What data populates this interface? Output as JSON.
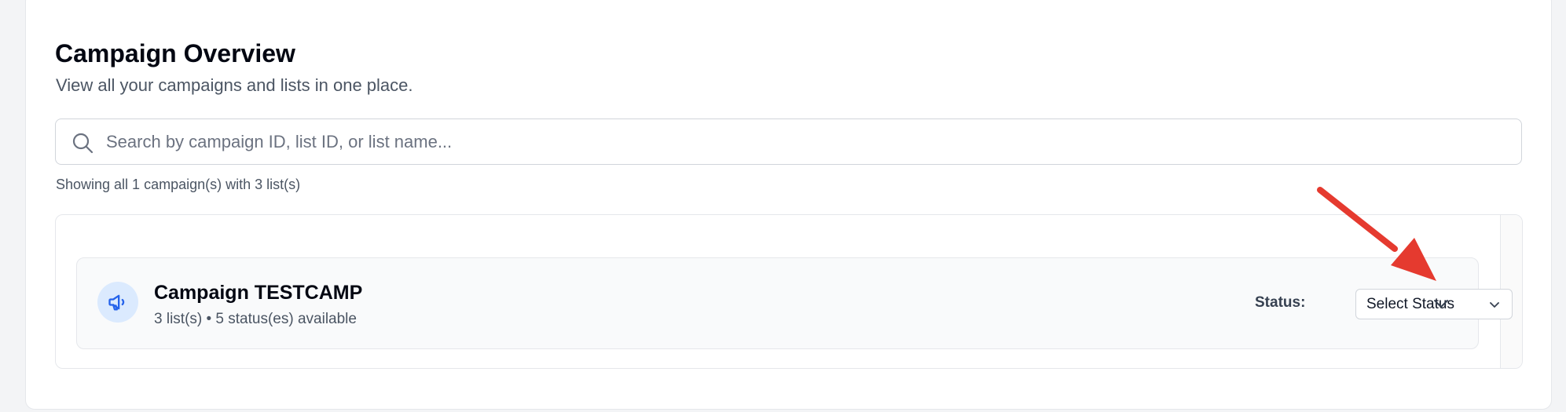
{
  "page": {
    "title": "Campaign Overview",
    "subtitle": "View all your campaigns and lists in one place."
  },
  "search": {
    "placeholder": "Search by campaign ID, list ID, or list name...",
    "value": "",
    "icon": "search-icon"
  },
  "summary": "Showing all 1 campaign(s) with 3 list(s)",
  "campaign": {
    "name": "Campaign TESTCAMP",
    "meta": "3 list(s) • 5 status(es) available",
    "icon": "megaphone-icon",
    "status_label": "Status:",
    "status_value": "Select Status",
    "expand_icon": "chevron-down-icon"
  },
  "colors": {
    "accent": "#2563eb",
    "icon_bg": "#dbeafe",
    "annotation": "#e53a2f"
  }
}
